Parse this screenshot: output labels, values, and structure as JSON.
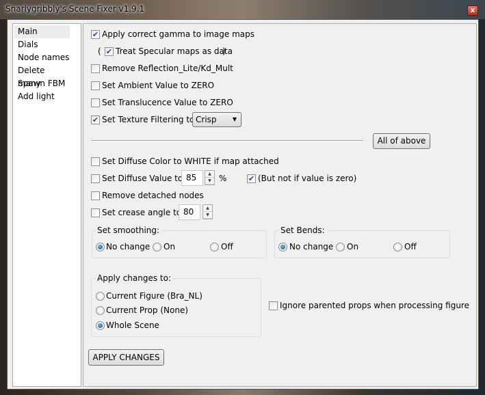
{
  "window": {
    "title": "Snarlygribbly's Scene Fixer v1.9.1",
    "close": "x"
  },
  "sidebar": {
    "items": [
      {
        "label": "Main"
      },
      {
        "label": "Dials"
      },
      {
        "label": "Node names"
      },
      {
        "label": "Delete many"
      },
      {
        "label": "Spawn FBM"
      },
      {
        "label": "Add light"
      }
    ]
  },
  "main": {
    "gamma": {
      "label": "Apply correct gamma to image maps",
      "checked": true
    },
    "specular": {
      "open": "(",
      "label": "Treat Specular maps as data",
      "close": ")",
      "checked": true
    },
    "reflection": {
      "label": "Remove Reflection_Lite/Kd_Mult",
      "checked": false
    },
    "ambient": {
      "label": "Set Ambient Value to ZERO",
      "checked": false
    },
    "translucence": {
      "label": "Set Translucence Value to ZERO",
      "checked": false
    },
    "filtering": {
      "label": "Set Texture Filtering to:",
      "checked": true,
      "value": "Crisp"
    },
    "all_above": "All of above",
    "diffuse_white": {
      "label": "Set Diffuse Color to WHITE if map attached",
      "checked": false
    },
    "diffuse_value": {
      "label": "Set Diffuse Value to:",
      "value": "85",
      "unit": "%",
      "checked": false
    },
    "not_zero": {
      "label": "(But not if value is zero)",
      "checked": true
    },
    "detached": {
      "label": "Remove detached nodes",
      "checked": false
    },
    "crease": {
      "label": "Set crease angle to:",
      "value": "80",
      "checked": false
    },
    "smoothing": {
      "title": "Set smoothing:",
      "options": [
        "No change",
        "On",
        "Off"
      ],
      "selected": "No change"
    },
    "bends": {
      "title": "Set Bends:",
      "options": [
        "No change",
        "On",
        "Off"
      ],
      "selected": "No change"
    },
    "apply_to": {
      "title": "Apply changes to:",
      "options": [
        "Current Figure (Bra_NL)",
        "Current Prop (None)",
        "Whole Scene"
      ],
      "selected": "Whole Scene"
    },
    "ignore_parented": {
      "label": "Ignore parented props when processing figure",
      "checked": false
    },
    "apply_button": "APPLY CHANGES"
  }
}
